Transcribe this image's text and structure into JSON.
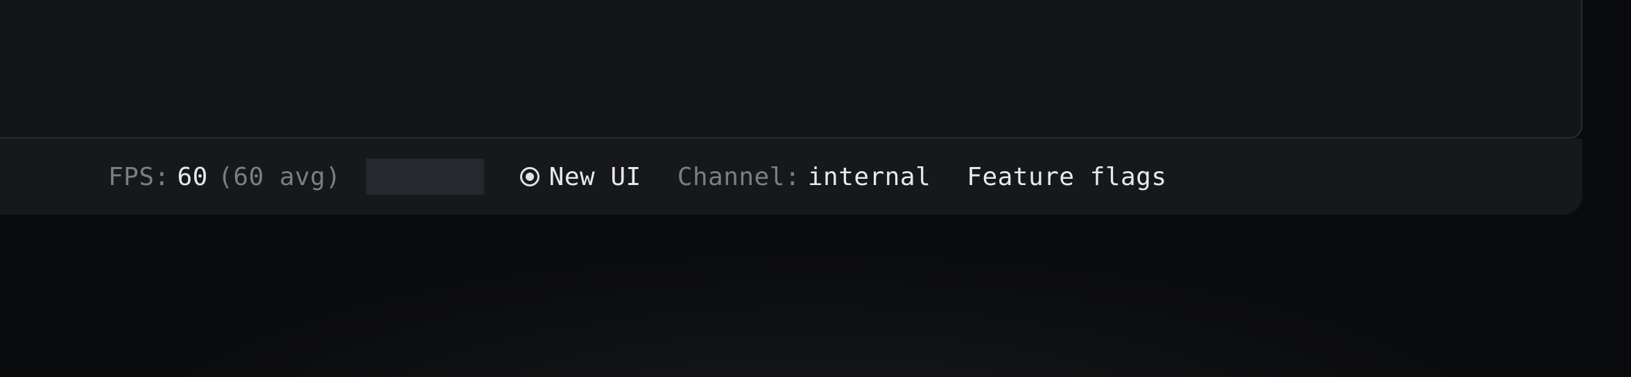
{
  "statusbar": {
    "fps": {
      "label": "FPS:",
      "current": "60",
      "avg_text": "(60 avg)"
    },
    "new_ui_label": "New UI",
    "channel": {
      "label": "Channel:",
      "value": "internal"
    },
    "feature_flags_label": "Feature flags"
  }
}
